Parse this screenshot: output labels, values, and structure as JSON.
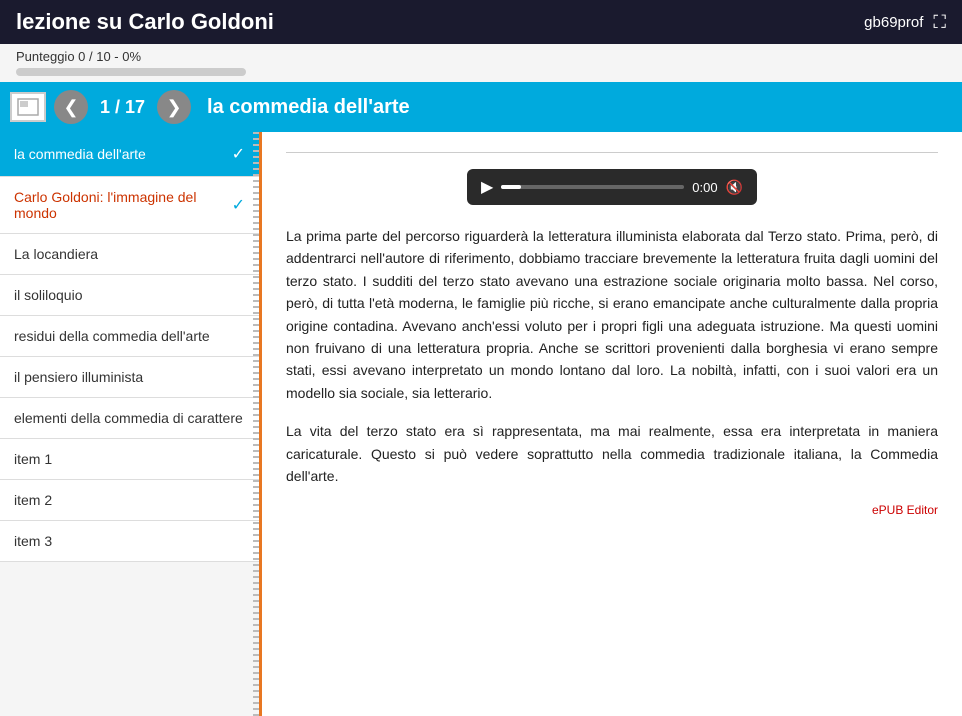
{
  "topbar": {
    "title": "lezione su Carlo Goldoni",
    "username": "gb69prof",
    "fullscreen_icon": "⛶"
  },
  "progress": {
    "label": "Punteggio 0 / 10 - 0%",
    "percent": 0
  },
  "navbar": {
    "prev_icon": "❮",
    "next_icon": "❯",
    "current_page": "1",
    "total_pages": "17",
    "slide_title": "la commedia dell'arte",
    "page_display": "1 / 17"
  },
  "sidebar": {
    "items": [
      {
        "id": "item-commedia",
        "label": "la commedia dell'arte",
        "active": true,
        "checked": true
      },
      {
        "id": "item-carlo",
        "label": "Carlo Goldoni: l'immagine del mondo",
        "active": false,
        "checked": true,
        "red": true
      },
      {
        "id": "item-locandiera",
        "label": "La locandiera",
        "active": false,
        "checked": false
      },
      {
        "id": "item-soliloquio",
        "label": "il soliloquio",
        "active": false,
        "checked": false
      },
      {
        "id": "item-residui",
        "label": "residui della commedia dell'arte",
        "active": false,
        "checked": false
      },
      {
        "id": "item-pensiero",
        "label": "il pensiero illuminista",
        "active": false,
        "checked": false
      },
      {
        "id": "item-elementi",
        "label": "elementi della commedia di carattere",
        "active": false,
        "checked": false
      },
      {
        "id": "item-1",
        "label": "item 1",
        "active": false,
        "checked": false
      },
      {
        "id": "item-2",
        "label": "item 2",
        "active": false,
        "checked": false
      },
      {
        "id": "item-3",
        "label": "item 3",
        "active": false,
        "checked": false
      }
    ]
  },
  "content": {
    "paragraph1": "La prima parte del percorso riguarderà la letteratura illuminista elaborata dal Terzo stato. Prima, però, di addentrarci nell'autore di riferimento, dobbiamo tracciare brevemente la letteratura fruita dagli uomini del terzo stato. I sudditi del terzo stato avevano una estrazione sociale originaria molto bassa. Nel corso, però, di tutta l'età moderna, le famiglie più ricche, si erano emancipate anche culturalmente dalla propria origine contadina. Avevano anch'essi voluto per i propri figli una adeguata istruzione. Ma questi uomini non fruivano di una letteratura propria. Anche se scrittori provenienti dalla borghesia vi erano sempre stati, essi avevano interpretato un mondo lontano dal loro. La nobiltà, infatti, con i suoi valori era un modello sia sociale, sia letterario.",
    "paragraph2": "La vita del terzo stato era sì rappresentata, ma mai realmente, essa era interpretata in maniera caricaturale. Questo si può vedere soprattutto nella commedia tradizionale italiana, la Commedia dell'arte.",
    "epub_watermark": "ePUB Editor"
  },
  "audio": {
    "time": "0:00"
  }
}
